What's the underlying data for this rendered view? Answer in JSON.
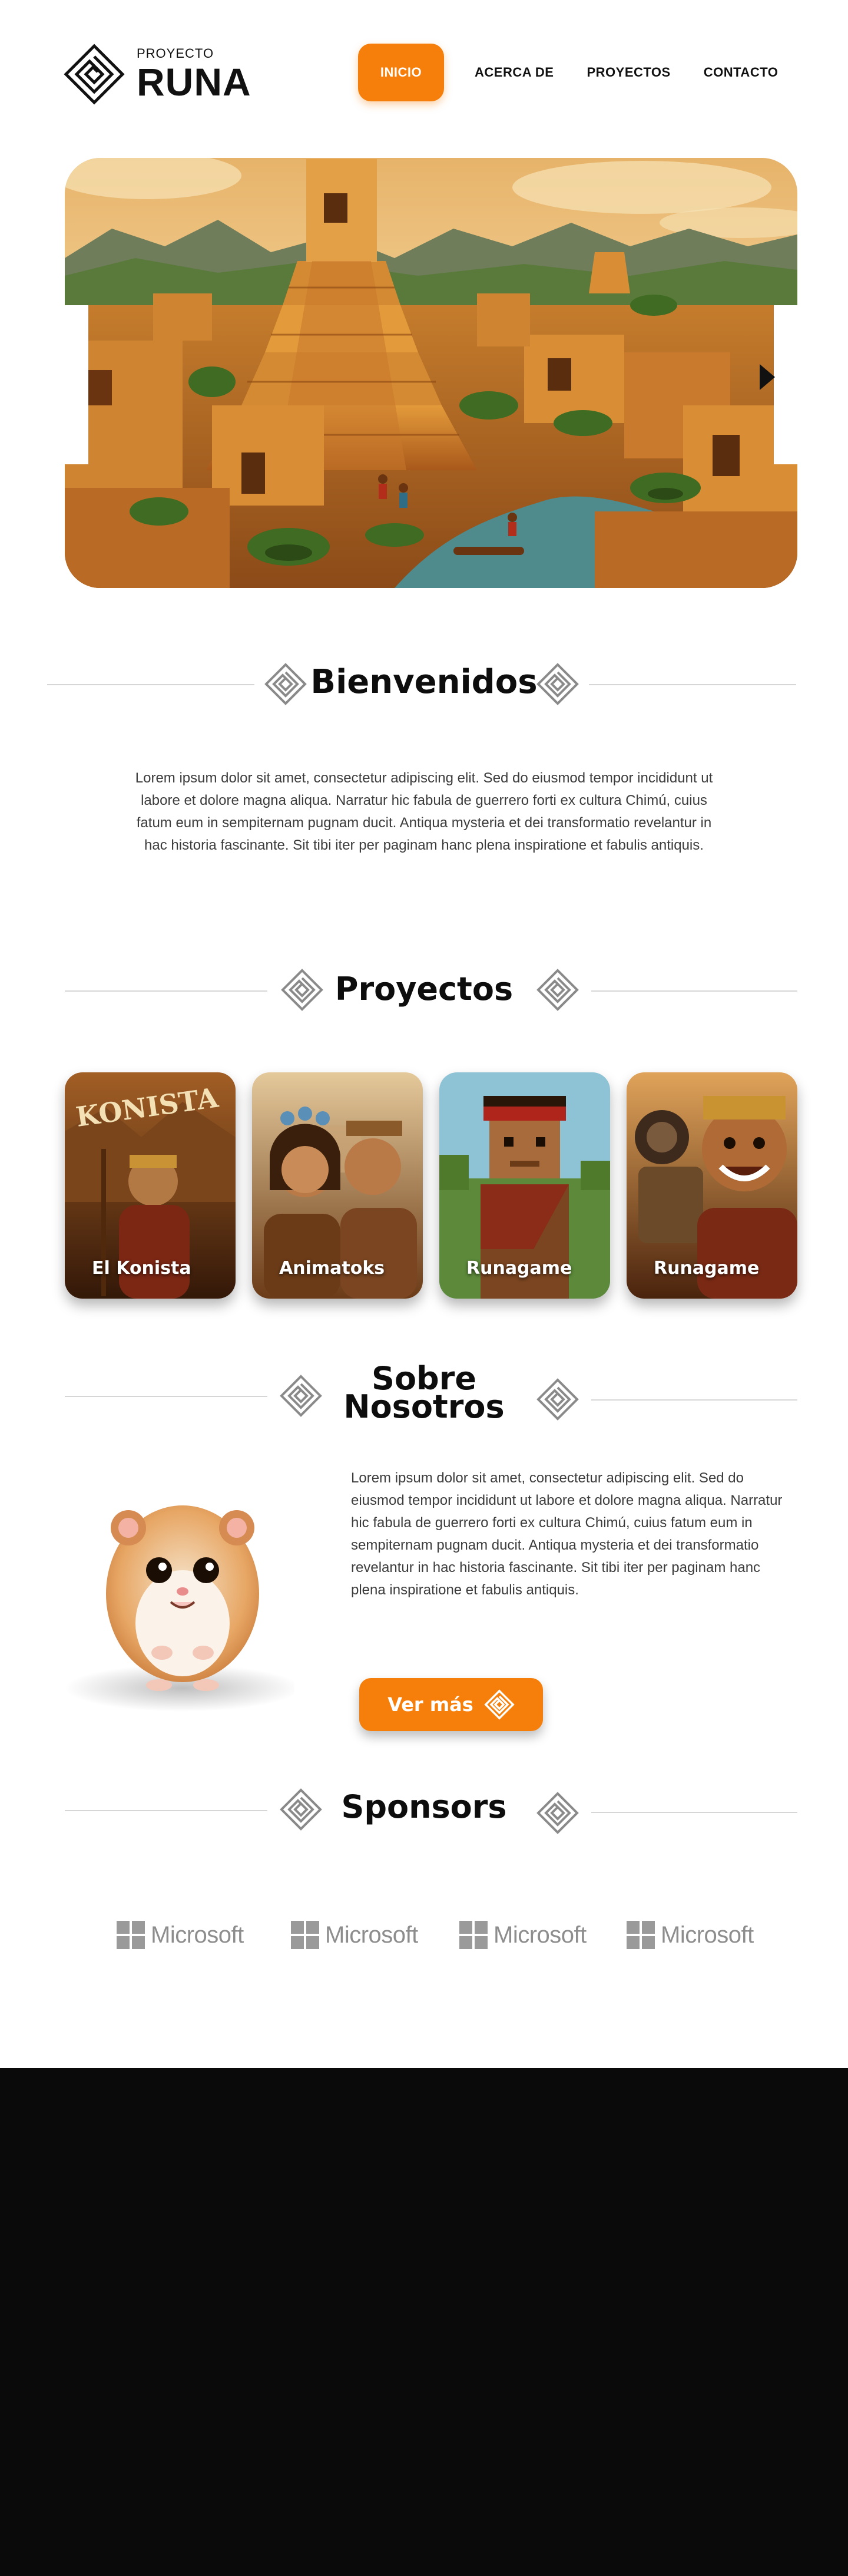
{
  "brand": {
    "pre": "PROYECTO",
    "name": "RUNA",
    "icon": "spiral-diamond-icon"
  },
  "nav": {
    "items": [
      {
        "label": "INICIO",
        "active": true
      },
      {
        "label": "ACERCA DE",
        "active": false
      },
      {
        "label": "PROYECTOS",
        "active": false
      },
      {
        "label": "CONTACTO",
        "active": false
      }
    ]
  },
  "hero": {
    "alt_icon": "next-arrow-icon"
  },
  "welcome": {
    "title": "Bienvenidos",
    "body": "Lorem ipsum dolor sit amet, consectetur adipiscing elit. Sed do eiusmod tempor incididunt ut labore et dolore magna aliqua. Narratur hic fabula de guerrero forti ex cultura Chimú, cuius fatum eum in sempiternam pugnam ducit. Antiqua mysteria et dei transformatio revelantur in hac historia fascinante. Sit tibi iter per paginam hanc plena inspiratione et fabulis antiquis."
  },
  "projects": {
    "title": "Proyectos",
    "cards": [
      {
        "label": "El Konista",
        "poster_text": "KONISTA"
      },
      {
        "label": "Animatoks"
      },
      {
        "label": "Runagame"
      },
      {
        "label": "Runagame"
      }
    ]
  },
  "about": {
    "title_line1": "Sobre",
    "title_line2": "Nosotros",
    "body": "Lorem ipsum dolor sit amet, consectetur adipiscing elit. Sed do eiusmod tempor incididunt ut labore et dolore magna aliqua. Narratur hic fabula de guerrero forti ex cultura Chimú, cuius fatum eum in sempiternam pugnam ducit. Antiqua mysteria et dei transformatio revelantur in hac historia fascinante. Sit tibi iter per paginam hanc plena inspiratione et fabulis antiquis.",
    "button_label": "Ver más"
  },
  "sponsors": {
    "title": "Sponsors",
    "items": [
      "Microsoft",
      "Microsoft",
      "Microsoft",
      "Microsoft"
    ]
  },
  "colors": {
    "accent": "#f57f0a",
    "text": "#111111",
    "muted": "#3c3c3c",
    "footer": "#0a0a0a"
  }
}
